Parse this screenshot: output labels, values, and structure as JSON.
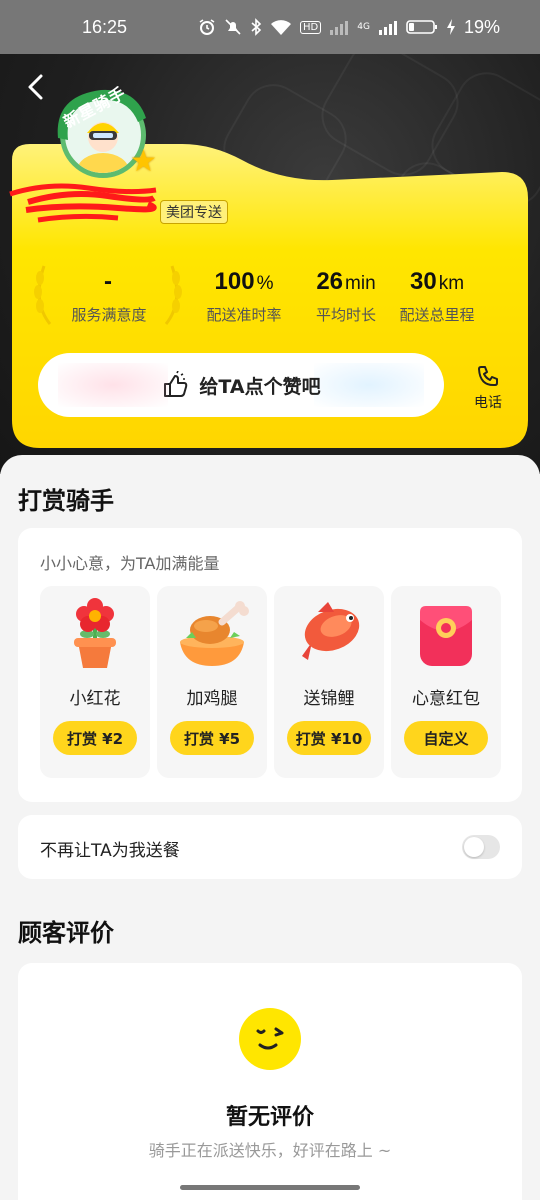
{
  "status_bar": {
    "time": "16:25",
    "network_badge": "HD",
    "signal_label": "4G",
    "battery_percent": "19%",
    "icons": [
      "alarm-icon",
      "mute-icon",
      "bluetooth-icon",
      "wifi-icon",
      "signal-icon",
      "battery-icon",
      "charging-icon"
    ]
  },
  "header": {
    "back_icon": "chevron-left-icon",
    "badge_text": "新星骑手",
    "brand_tag": "美团专送"
  },
  "stats": [
    {
      "value": "-",
      "unit": "",
      "label": "服务满意度"
    },
    {
      "value": "100",
      "unit": "%",
      "label": "配送准时率"
    },
    {
      "value": "26",
      "unit": "min",
      "label": "平均时长"
    },
    {
      "value": "30",
      "unit": "km",
      "label": "配送总里程"
    }
  ],
  "like_button": {
    "label": "给TA点个赞吧",
    "icon": "thumbs-up-icon"
  },
  "phone_button": {
    "label": "电话",
    "icon": "phone-icon"
  },
  "tip_section": {
    "title": "打赏骑手",
    "subtitle": "小小心意，为TA加满能量",
    "gifts": [
      {
        "name": "小红花",
        "button": "打赏 ¥2",
        "icon": "flower-pot-icon"
      },
      {
        "name": "加鸡腿",
        "button": "打赏 ¥5",
        "icon": "chicken-leg-icon"
      },
      {
        "name": "送锦鲤",
        "button": "打赏 ¥10",
        "icon": "koi-fish-icon"
      },
      {
        "name": "心意红包",
        "button": "自定义",
        "icon": "red-envelope-icon"
      }
    ]
  },
  "block_setting": {
    "label": "不再让TA为我送餐",
    "enabled": false
  },
  "review_section": {
    "title": "顾客评价",
    "empty_title": "暂无评价",
    "empty_subtitle": "骑手正在派送快乐，好评在路上 ~",
    "empty_icon": "winking-face-icon"
  },
  "colors": {
    "accent_yellow": "#ffd51c",
    "card_yellow": "#ffe600",
    "hero_dark": "#1f1f1f",
    "badge_green": "#5dbb6f"
  }
}
